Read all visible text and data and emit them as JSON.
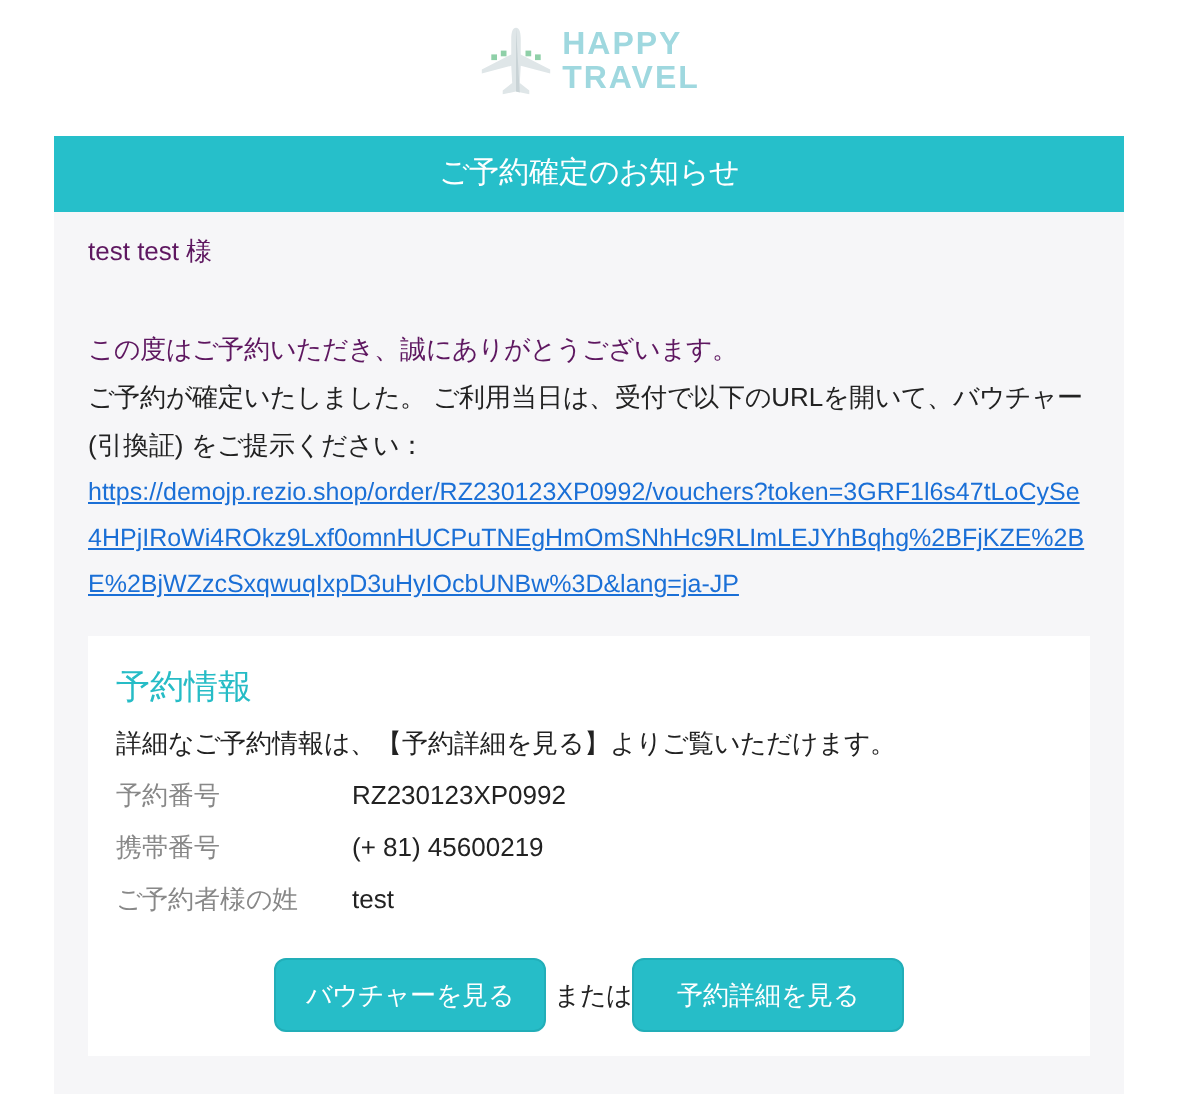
{
  "logo": {
    "line_1": "HAPPY",
    "line_2": "TRAVEL"
  },
  "header": {
    "title": "ご予約確定のお知らせ"
  },
  "greeting": "test test 様",
  "thanks": "この度はご予約いただき、誠にありがとうございます。",
  "message": {
    "text": "ご予約が確定いたしました。 ご利用当日は、受付で以下のURLを開いて、バウチャー (引換証) をご提示ください：",
    "link": "https://demojp.rezio.shop/order/RZ230123XP0992/vouchers?token=3GRF1l6s47tLoCySe4HPjIRoWi4ROkz9Lxf0omnHUCPuTNEgHmOmSNhHc9RLImLEJYhBqhg%2BFjKZE%2BE%2BjWZzcSxqwuqIxpD3uHyIOcbUNBw%3D&lang=ja-JP"
  },
  "reservation": {
    "title": "予約情報",
    "note": "詳細なご予約情報は、【予約詳細を見る】よりご覧いただけます。",
    "rows": [
      {
        "label": "予約番号",
        "value": "RZ230123XP0992"
      },
      {
        "label": "携帯番号",
        "value": "(+ 81) 45600219"
      },
      {
        "label": "ご予約者様の姓",
        "value": "test"
      }
    ],
    "buttons": [
      "バウチャーを見る",
      "予約詳細を見る"
    ],
    "separator": "または"
  }
}
